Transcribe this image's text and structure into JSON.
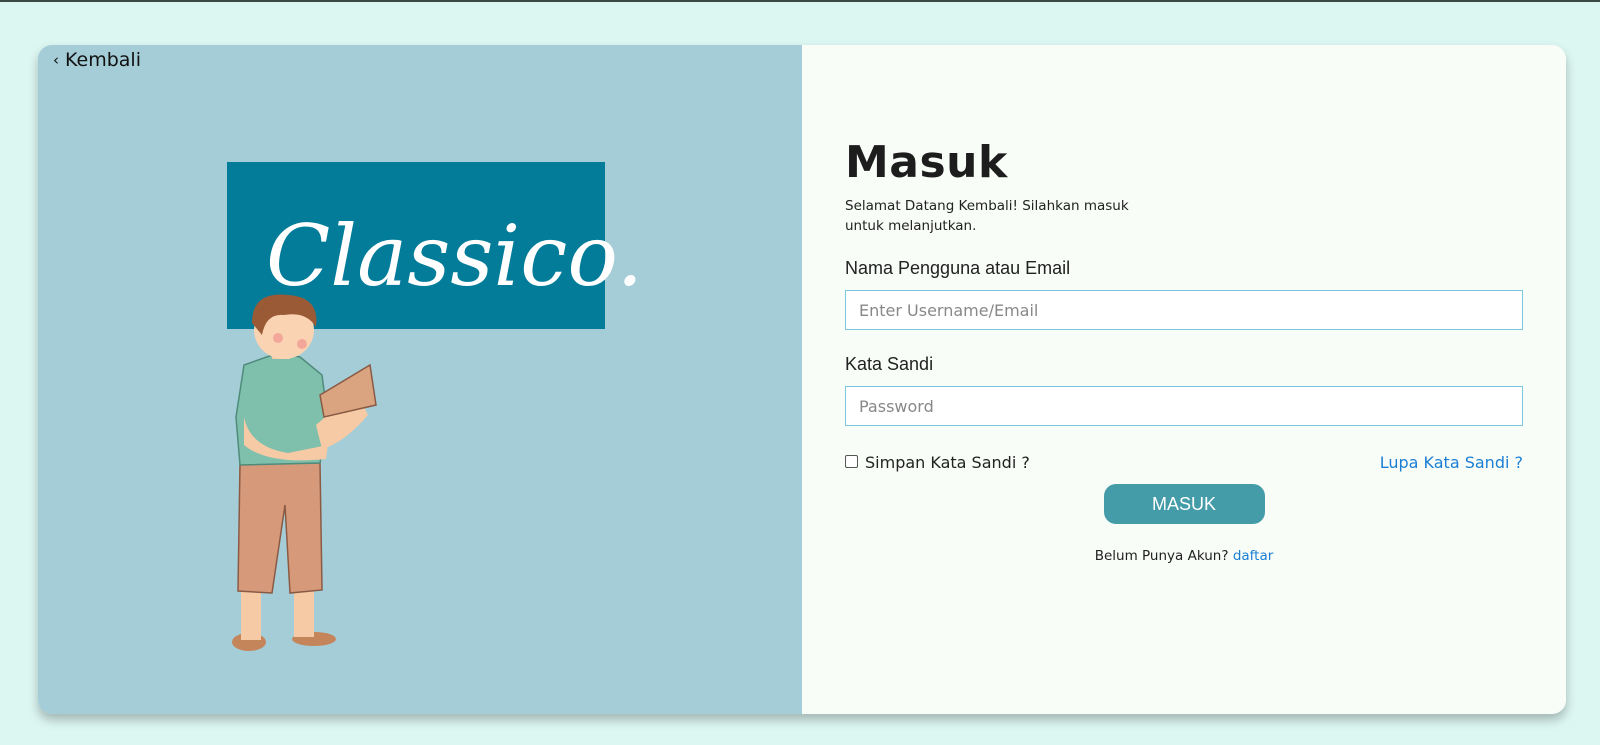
{
  "nav": {
    "back_label": "Kembali",
    "back_icon": "chevron-left-icon"
  },
  "hero": {
    "logo_text": "Classico.",
    "logo_color": "#027c99"
  },
  "form": {
    "title": "Masuk",
    "subtitle": "Selamat Datang Kembali! Silahkan masuk untuk melanjutkan.",
    "username_label": "Nama Pengguna atau Email",
    "username_placeholder": "Enter Username/Email",
    "password_label": "Kata Sandi",
    "password_placeholder": "Password",
    "remember_label": "Simpan Kata Sandi ?",
    "remember_checked": false,
    "forgot_label": "Lupa Kata Sandi ?",
    "submit_label": "MASUK",
    "signup_prompt": "Belum Punya Akun?",
    "signup_link": "daftar"
  },
  "colors": {
    "page_bg": "#dcf6f2",
    "left_panel_bg": "#a4cdd7",
    "right_panel_bg": "#f9fdf8",
    "button_bg": "#459ca9",
    "link": "#1a7fd4",
    "input_border": "#79c8dc"
  }
}
